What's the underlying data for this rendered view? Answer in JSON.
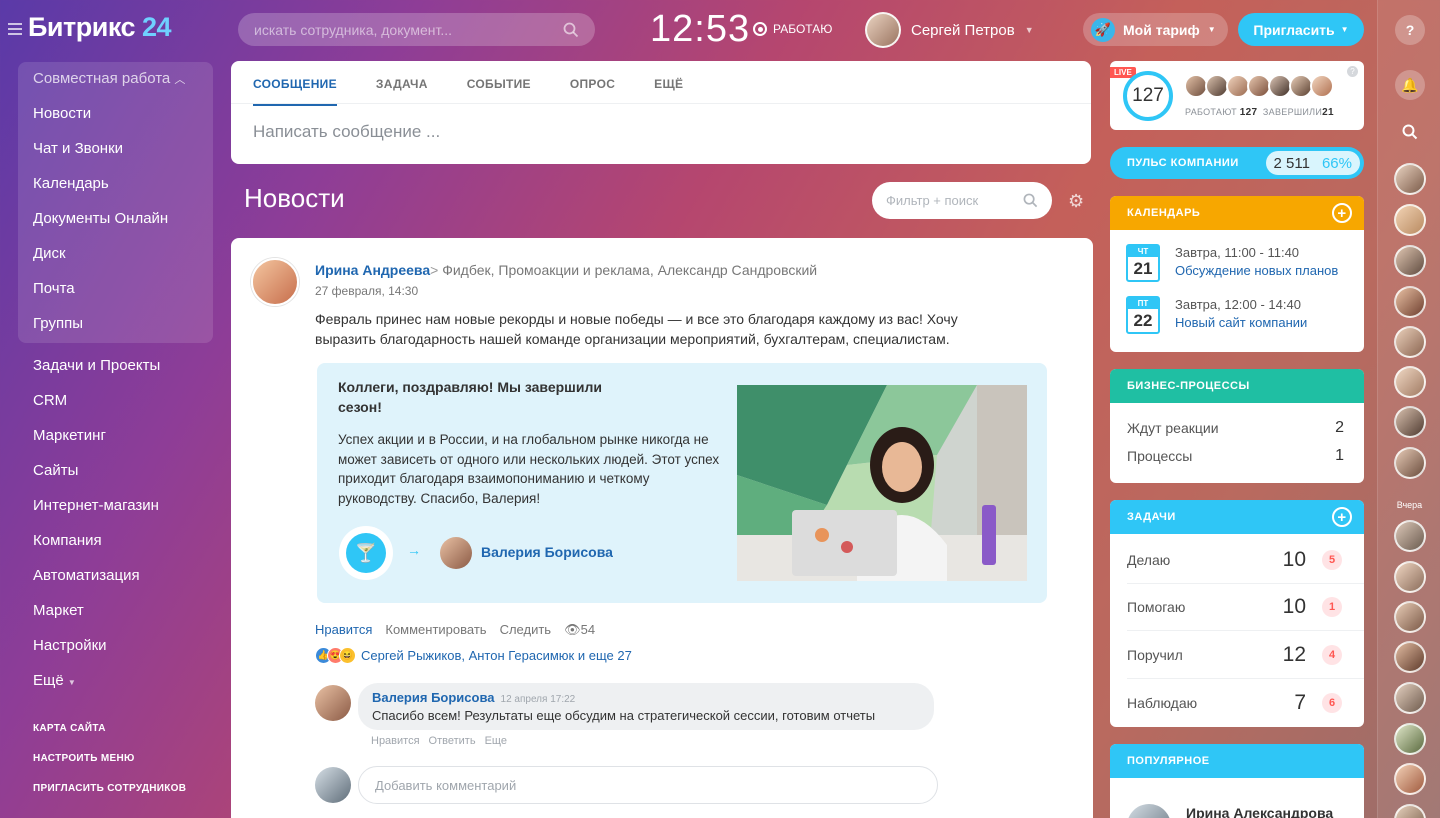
{
  "header": {
    "logo_main": "Битрикс",
    "logo_num": "24",
    "search_placeholder": "искать сотрудника, документ...",
    "clock": "12:53",
    "status": "РАБОТАЮ",
    "user_name": "Сергей Петров",
    "tariff_label": "Мой тариф",
    "invite_label": "Пригласить"
  },
  "sidebar": {
    "group_title": "Совместная работа",
    "group_items": [
      "Новости",
      "Чат и Звонки",
      "Календарь",
      "Документы Онлайн",
      "Диск",
      "Почта",
      "Группы"
    ],
    "items": [
      "Задачи и Проекты",
      "CRM",
      "Маркетинг",
      "Сайты",
      "Интернет-магазин",
      "Компания",
      "Автоматизация",
      "Маркет",
      "Настройки",
      "Ещё"
    ],
    "footer_links": [
      "КАРТА САЙТА",
      "НАСТРОИТЬ МЕНЮ",
      "ПРИГЛАСИТЬ СОТРУДНИКОВ"
    ]
  },
  "composer": {
    "tabs": [
      "СООБЩЕНИЕ",
      "ЗАДАЧА",
      "СОБЫТИЕ",
      "ОПРОС",
      "ЕЩЁ"
    ],
    "placeholder": "Написать сообщение ..."
  },
  "feed": {
    "title": "Новости",
    "filter_placeholder": "Фильтр + поиск"
  },
  "post": {
    "author": "Ирина Андреева",
    "recipients": "Фидбек, Промоакции и реклама, Александр Сандровский",
    "date": "27 февраля, 14:30",
    "text": "Февраль принес нам новые рекорды и новые победы — и все это благодаря каждому из вас! Хочу выразить благодарность нашей команде организации мероприятий, бухгалтерам, специалистам.",
    "grat_title": "Коллеги, поздравляю! Мы завершили сезон!",
    "grat_body": "Успех акции и в России, и на глобальном рынке никогда не может зависеть от одного или нескольких людей. Этот успех приходит благодаря взаимопониманию и четкому руководству. Спасибо, Валерия!",
    "grat_user": "Валерия Борисова",
    "like": "Нравится",
    "comment": "Комментировать",
    "follow": "Следить",
    "views": "54",
    "reactions_text": "Сергей Рыжиков, Антон Герасимюк и еще 27",
    "comment_author": "Валерия Борисова",
    "comment_date": "12 апреля 17:22",
    "comment_text": "Спасибо всем! Результаты еще обсудим на стратегической сессии, готовим отчеты",
    "comment_actions": [
      "Нравится",
      "Ответить",
      "Еще"
    ],
    "add_comment_placeholder": "Добавить комментарий"
  },
  "widgets": {
    "live": {
      "badge": "LIVE",
      "count": "127",
      "working_label": "РАБОТАЮТ",
      "working": "127",
      "finished_label": "ЗАВЕРШИЛИ",
      "finished": "21"
    },
    "pulse": {
      "title": "ПУЛЬС КОМПАНИИ",
      "value": "2 511",
      "percent": "66%"
    },
    "calendar": {
      "title": "КАЛЕНДАРЬ",
      "events": [
        {
          "dow": "ЧТ",
          "day": "21",
          "time": "Завтра, 11:00 - 11:40",
          "name": "Обсуждение новых планов"
        },
        {
          "dow": "ПТ",
          "day": "22",
          "time": "Завтра, 12:00 - 14:40",
          "name": "Новый сайт компании"
        }
      ]
    },
    "bp": {
      "title": "БИЗНЕС-ПРОЦЕССЫ",
      "rows": [
        {
          "label": "Ждут реакции",
          "value": "2"
        },
        {
          "label": "Процессы",
          "value": "1"
        }
      ]
    },
    "tasks": {
      "title": "ЗАДАЧИ",
      "rows": [
        {
          "label": "Делаю",
          "value": "10",
          "badge": "5"
        },
        {
          "label": "Помогаю",
          "value": "10",
          "badge": "1"
        },
        {
          "label": "Поручил",
          "value": "12",
          "badge": "4"
        },
        {
          "label": "Наблюдаю",
          "value": "7",
          "badge": "6"
        }
      ]
    },
    "popular": {
      "title": "ПОПУЛЯРНОЕ",
      "name": "Ирина Александрова"
    }
  },
  "rail": {
    "yesterday": "Вчера"
  }
}
